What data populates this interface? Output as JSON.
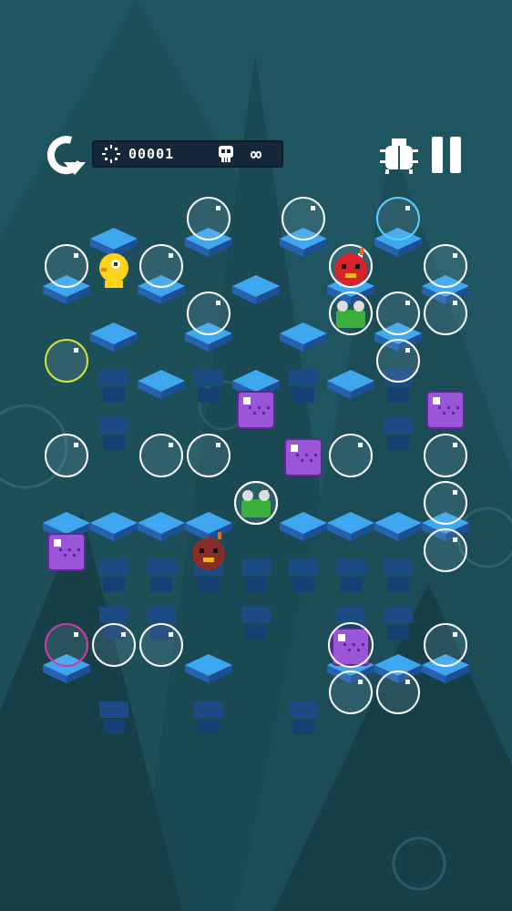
{
  "hud": {
    "moves_counter": "00001",
    "lives": "∞",
    "restart_icon": "restart-arrow-icon",
    "moves_icon": "moves-dotted-circle-icon",
    "skull_icon": "skull-icon",
    "bug_icon": "bug-icon",
    "pause_icon": "pause-icon"
  },
  "colors": {
    "background": "#1f5560",
    "platform_top": "#3fa6f0",
    "platform_side": "#2762b0",
    "bubble_outline": "#ffffff",
    "player": "#ffd21c",
    "bomb_red": "#d8212a",
    "frog_green": "#3cae3a",
    "purple_block": "#9a55d8",
    "counter_bg": "#14283a"
  },
  "board": {
    "columns": 9,
    "rows": 11,
    "pieces": [
      {
        "type": "player-chick",
        "name": "player-character",
        "row": 1,
        "col": 1
      },
      {
        "type": "red-bomb",
        "name": "red-bomb-enemy",
        "row": 1,
        "col": 6
      },
      {
        "type": "dark-bomb",
        "name": "dark-bomb-enemy",
        "row": 7,
        "col": 3
      },
      {
        "type": "frog-in-bubble",
        "name": "frog-enemy",
        "row": 2,
        "col": 6
      },
      {
        "type": "frog-in-bubble",
        "name": "frog-enemy",
        "row": 6,
        "col": 4
      },
      {
        "type": "purple-cube",
        "name": "purple-cube-block",
        "row": 4,
        "col": 4
      },
      {
        "type": "purple-cube",
        "name": "purple-cube-block",
        "row": 4,
        "col": 8
      },
      {
        "type": "purple-cube",
        "name": "purple-cube-block",
        "row": 5,
        "col": 5
      },
      {
        "type": "purple-cube",
        "name": "purple-cube-block",
        "row": 7,
        "col": 0
      },
      {
        "type": "purple-cube-bubble",
        "name": "purple-cube-block",
        "row": 9,
        "col": 6
      }
    ]
  }
}
